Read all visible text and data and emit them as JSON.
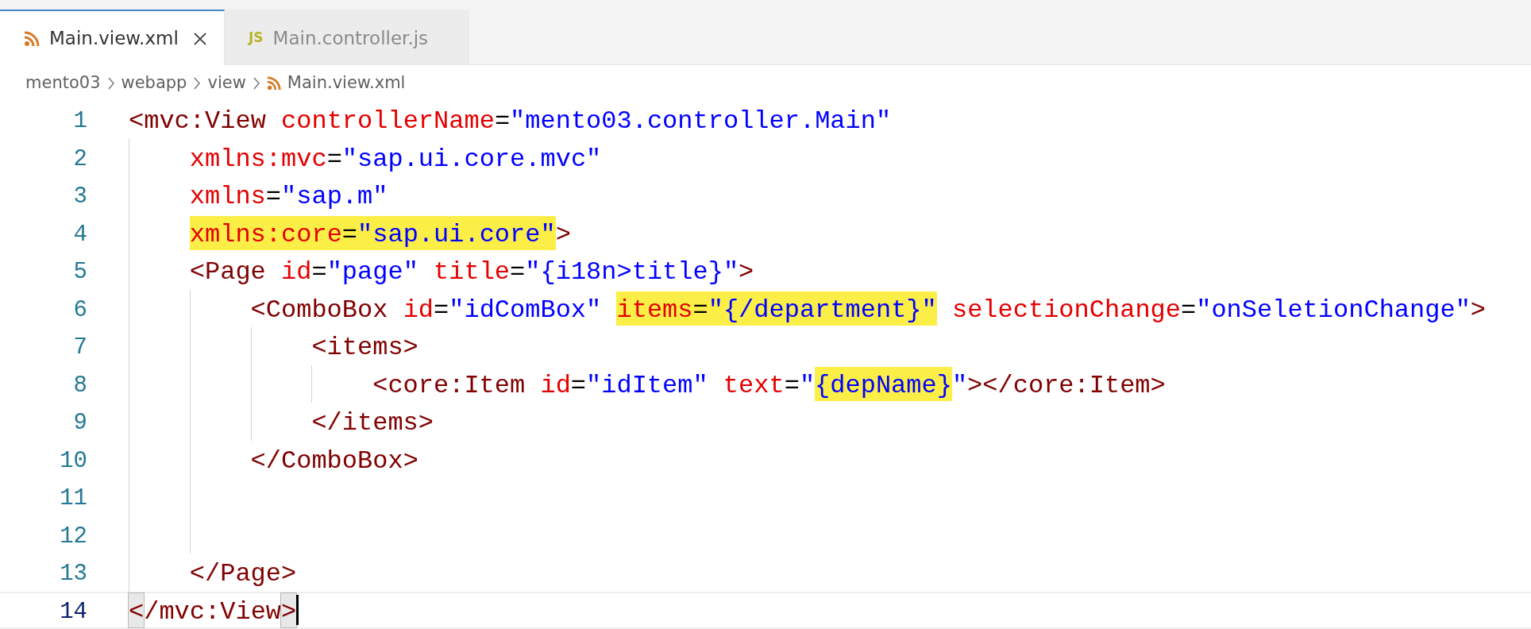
{
  "tabs": [
    {
      "label": "Main.view.xml",
      "kind": "xml",
      "selected": true,
      "closable": true
    },
    {
      "label": "Main.controller.js",
      "kind": "js",
      "type_label": "JS",
      "selected": false,
      "closable": false
    }
  ],
  "breadcrumb": [
    {
      "label": "mento03"
    },
    {
      "label": "webapp"
    },
    {
      "label": "view"
    },
    {
      "label": "Main.view.xml",
      "kind": "xml"
    }
  ],
  "code_lines": [
    {
      "number": "1",
      "current": false,
      "tokens": [
        {
          "kind": "tag",
          "text": "<mvc:View"
        },
        {
          "kind": "attr",
          "text": " controllerName"
        },
        {
          "kind": "punct",
          "text": "="
        },
        {
          "kind": "string",
          "text": "\"mento03.controller.Main\""
        }
      ],
      "children": [
        {
          "number": "2",
          "current": false,
          "tokens": [
            {
              "kind": "attr",
              "text": "xmlns:mvc"
            },
            {
              "kind": "punct",
              "text": "="
            },
            {
              "kind": "string",
              "text": "\"sap.ui.core.mvc\""
            }
          ]
        },
        {
          "number": "3",
          "current": false,
          "tokens": [
            {
              "kind": "attr",
              "text": "xmlns"
            },
            {
              "kind": "punct",
              "text": "="
            },
            {
              "kind": "string",
              "text": "\"sap.m\""
            }
          ]
        },
        {
          "number": "4",
          "current": false,
          "tokens": [
            {
              "kind": "attr",
              "text": "xmlns:core",
              "highlighted": true
            },
            {
              "kind": "punct",
              "text": "=",
              "highlighted": true
            },
            {
              "kind": "string",
              "text": "\"sap.ui.core\"",
              "highlighted": true
            },
            {
              "kind": "tag",
              "text": ">"
            }
          ]
        },
        {
          "number": "5",
          "current": false,
          "tokens": [
            {
              "kind": "tag",
              "text": "<Page"
            },
            {
              "kind": "attr",
              "text": " id"
            },
            {
              "kind": "punct",
              "text": "="
            },
            {
              "kind": "string",
              "text": "\"page\""
            },
            {
              "kind": "attr",
              "text": " title"
            },
            {
              "kind": "punct",
              "text": "="
            },
            {
              "kind": "string",
              "text": "\"{i18n>title}\""
            },
            {
              "kind": "tag",
              "text": ">"
            }
          ],
          "children": [
            {
              "number": "6",
              "current": false,
              "tokens": [
                {
                  "kind": "tag",
                  "text": "<ComboBox"
                },
                {
                  "kind": "attr",
                  "text": " id"
                },
                {
                  "kind": "punct",
                  "text": "="
                },
                {
                  "kind": "string",
                  "text": "\"idComBox\" "
                },
                {
                  "kind": "attr",
                  "text": "items",
                  "highlighted": true
                },
                {
                  "kind": "punct",
                  "text": "=",
                  "highlighted": true
                },
                {
                  "kind": "string",
                  "text": "\"{/department}\"",
                  "highlighted": true
                },
                {
                  "kind": "attr",
                  "text": " selectionChange"
                },
                {
                  "kind": "punct",
                  "text": "="
                },
                {
                  "kind": "string",
                  "text": "\"onSeletionChange\""
                },
                {
                  "kind": "tag",
                  "text": ">"
                }
              ],
              "children": [
                {
                  "number": "7",
                  "current": false,
                  "tokens": [
                    {
                      "kind": "tag",
                      "text": "<items>"
                    }
                  ],
                  "children": [
                    {
                      "number": "8",
                      "current": false,
                      "tokens": [
                        {
                          "kind": "tag",
                          "text": "<core:Item"
                        },
                        {
                          "kind": "attr",
                          "text": " id"
                        },
                        {
                          "kind": "punct",
                          "text": "="
                        },
                        {
                          "kind": "string",
                          "text": "\"idItem\""
                        },
                        {
                          "kind": "attr",
                          "text": " text"
                        },
                        {
                          "kind": "punct",
                          "text": "="
                        },
                        {
                          "kind": "string",
                          "text": "\""
                        },
                        {
                          "kind": "string",
                          "text": "{depName}",
                          "highlighted": true
                        },
                        {
                          "kind": "string",
                          "text": "\""
                        },
                        {
                          "kind": "tag",
                          "text": "></core:Item>"
                        }
                      ]
                    }
                  ]
                },
                {
                  "number": "9",
                  "current": false,
                  "tokens": [
                    {
                      "kind": "tag",
                      "text": "</items>"
                    }
                  ]
                }
              ]
            },
            {
              "number": "10",
              "current": false,
              "tokens": [
                {
                  "kind": "tag",
                  "text": "</ComboBox>"
                }
              ]
            },
            {
              "number": "11",
              "current": false
            },
            {
              "number": "12",
              "current": false
            }
          ]
        },
        {
          "number": "13",
          "current": false,
          "tokens": [
            {
              "kind": "tag",
              "text": "</Page>"
            }
          ]
        }
      ]
    },
    {
      "number": "14",
      "current": true,
      "tokens": [
        {
          "kind": "tag",
          "text": "<",
          "bracket_match": true
        },
        {
          "kind": "tag",
          "text": "/mvc:View"
        },
        {
          "kind": "tag",
          "text": ">",
          "bracket_match": true
        }
      ]
    }
  ]
}
